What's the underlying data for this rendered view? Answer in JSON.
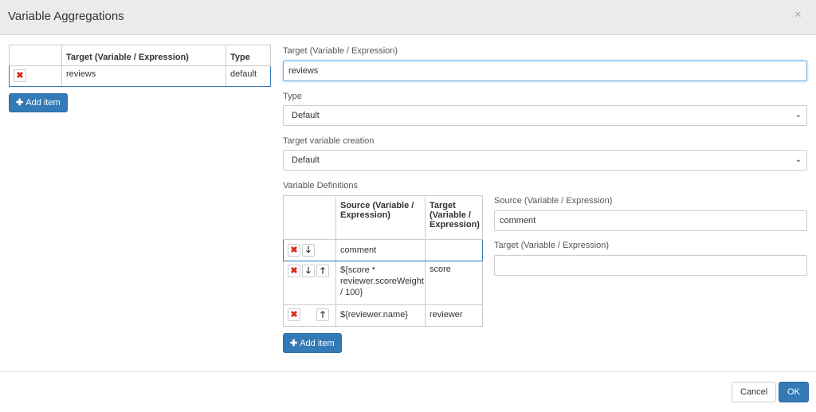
{
  "dialog": {
    "title": "Variable Aggregations",
    "close_label": "×"
  },
  "aggregations": {
    "columns": [
      "",
      "Target (Variable / Expression)",
      "Type"
    ],
    "rows": [
      {
        "target": "reviews",
        "type": "default"
      }
    ],
    "add_label": "Add item"
  },
  "form": {
    "target_label": "Target (Variable / Expression)",
    "target_value": "reviews",
    "type_label": "Type",
    "type_value": "Default",
    "creation_label": "Target variable creation",
    "creation_value": "Default",
    "definitions_label": "Variable Definitions"
  },
  "definitions": {
    "columns": [
      "",
      "Source (Variable / Expression)",
      "Target (Variable / Expression)"
    ],
    "rows": [
      {
        "source": "comment",
        "target": ""
      },
      {
        "source": "${score * reviewer.scoreWeight / 100}",
        "target": "score"
      },
      {
        "source": "${reviewer.name}",
        "target": "reviewer"
      }
    ],
    "add_label": "Add item"
  },
  "detail": {
    "source_label": "Source (Variable / Expression)",
    "source_value": "comment",
    "target_label": "Target (Variable / Expression)",
    "target_value": ""
  },
  "footer": {
    "cancel_label": "Cancel",
    "ok_label": "OK"
  },
  "icons": {
    "delete": "✖",
    "down": "🡓",
    "up": "🡑",
    "plus": "✚",
    "caret": "⌄"
  },
  "colors": {
    "primary": "#337ab7",
    "delete": "#d9261c"
  }
}
